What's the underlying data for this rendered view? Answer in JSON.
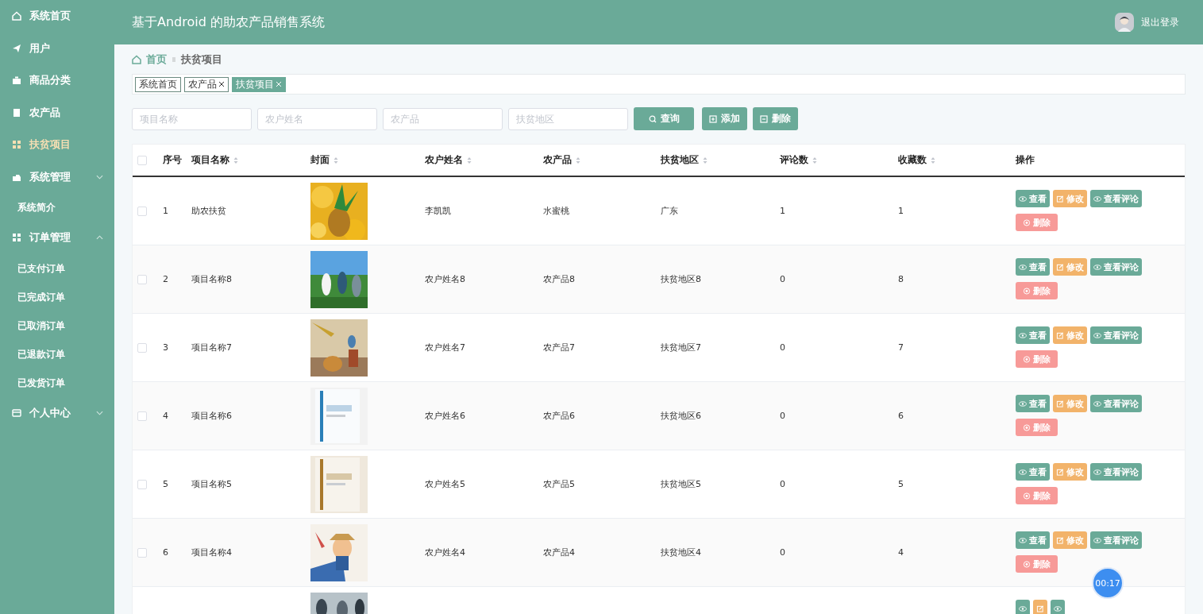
{
  "app_title": "基于Android 的助农产品销售系统",
  "user": {
    "logout": "退出登录"
  },
  "sidebar": {
    "items": [
      {
        "label": "系统首页",
        "selected": false
      },
      {
        "label": "用户",
        "selected": false
      },
      {
        "label": "商品分类",
        "selected": false
      },
      {
        "label": "农产品",
        "selected": false
      },
      {
        "label": "扶贫项目",
        "selected": true
      },
      {
        "label": "系统管理",
        "selected": false,
        "expanded": false,
        "children": [
          {
            "label": "系统简介"
          }
        ]
      },
      {
        "label": "订单管理",
        "selected": false,
        "expanded": true,
        "children": [
          {
            "label": "已支付订单"
          },
          {
            "label": "已完成订单"
          },
          {
            "label": "已取消订单"
          },
          {
            "label": "已退款订单"
          },
          {
            "label": "已发货订单"
          }
        ]
      },
      {
        "label": "个人中心",
        "selected": false,
        "expanded": false
      }
    ]
  },
  "breadcrumb": [
    "首页",
    "扶贫项目"
  ],
  "tags": [
    {
      "label": "系统首页",
      "selected": false,
      "closable": false
    },
    {
      "label": "农产品",
      "selected": false,
      "closable": true
    },
    {
      "label": "扶贫项目",
      "selected": true,
      "closable": true
    }
  ],
  "filters": [
    {
      "placeholder": "项目名称"
    },
    {
      "placeholder": "农户姓名"
    },
    {
      "placeholder": "农产品"
    },
    {
      "placeholder": "扶贫地区"
    }
  ],
  "toolbar": [
    {
      "label": "查询",
      "kind": "search"
    },
    {
      "label": "添加",
      "kind": "add"
    },
    {
      "label": "删除",
      "kind": "delete"
    }
  ],
  "table": {
    "all_checked": false,
    "columns": [
      {
        "label": "序号",
        "sortable": false
      },
      {
        "label": "项目名称",
        "sortable": true
      },
      {
        "label": "封面",
        "sortable": true
      },
      {
        "label": "农户姓名",
        "sortable": true
      },
      {
        "label": "农产品",
        "sortable": true
      },
      {
        "label": "扶贫地区",
        "sortable": true
      },
      {
        "label": "评论数",
        "sortable": true
      },
      {
        "label": "收藏数",
        "sortable": true
      },
      {
        "label": "操作",
        "sortable": false
      }
    ],
    "rows": [
      {
        "cells": [
          "1",
          "助农扶贫",
          "",
          "李凯凯",
          "水蜜桃",
          "广东",
          "1",
          "1"
        ],
        "checked": false,
        "actions": [
          {
            "label": "查看",
            "kind": "view"
          },
          {
            "label": "修改",
            "kind": "edit"
          },
          {
            "label": "查看评论",
            "kind": "view"
          },
          {
            "label": "删除",
            "kind": "delete"
          }
        ]
      },
      {
        "cells": [
          "2",
          "项目名称8",
          "",
          "农户姓名8",
          "农产品8",
          "扶贫地区8",
          "0",
          "8"
        ],
        "checked": false,
        "actions": [
          {
            "label": "查看",
            "kind": "view"
          },
          {
            "label": "修改",
            "kind": "edit"
          },
          {
            "label": "查看评论",
            "kind": "view"
          },
          {
            "label": "删除",
            "kind": "delete"
          }
        ]
      },
      {
        "cells": [
          "3",
          "项目名称7",
          "",
          "农户姓名7",
          "农产品7",
          "扶贫地区7",
          "0",
          "7"
        ],
        "checked": false,
        "actions": [
          {
            "label": "查看",
            "kind": "view"
          },
          {
            "label": "修改",
            "kind": "edit"
          },
          {
            "label": "查看评论",
            "kind": "view"
          },
          {
            "label": "删除",
            "kind": "delete"
          }
        ]
      },
      {
        "cells": [
          "4",
          "项目名称6",
          "",
          "农户姓名6",
          "农产品6",
          "扶贫地区6",
          "0",
          "6"
        ],
        "checked": false,
        "actions": [
          {
            "label": "查看",
            "kind": "view"
          },
          {
            "label": "修改",
            "kind": "edit"
          },
          {
            "label": "查看评论",
            "kind": "view"
          },
          {
            "label": "删除",
            "kind": "delete"
          }
        ]
      },
      {
        "cells": [
          "5",
          "项目名称5",
          "",
          "农户姓名5",
          "农产品5",
          "扶贫地区5",
          "0",
          "5"
        ],
        "checked": false,
        "actions": [
          {
            "label": "查看",
            "kind": "view"
          },
          {
            "label": "修改",
            "kind": "edit"
          },
          {
            "label": "查看评论",
            "kind": "view"
          },
          {
            "label": "删除",
            "kind": "delete"
          }
        ]
      },
      {
        "cells": [
          "6",
          "项目名称4",
          "",
          "农户姓名4",
          "农产品4",
          "扶贫地区4",
          "0",
          "4"
        ],
        "checked": false,
        "actions": [
          {
            "label": "查看",
            "kind": "view"
          },
          {
            "label": "修改",
            "kind": "edit"
          },
          {
            "label": "查看评论",
            "kind": "view"
          },
          {
            "label": "删除",
            "kind": "delete"
          }
        ]
      },
      {
        "actions": [
          {
            "kind": "view"
          },
          {
            "kind": "edit"
          },
          {
            "kind": "view"
          }
        ]
      }
    ]
  },
  "timer": "00:17"
}
